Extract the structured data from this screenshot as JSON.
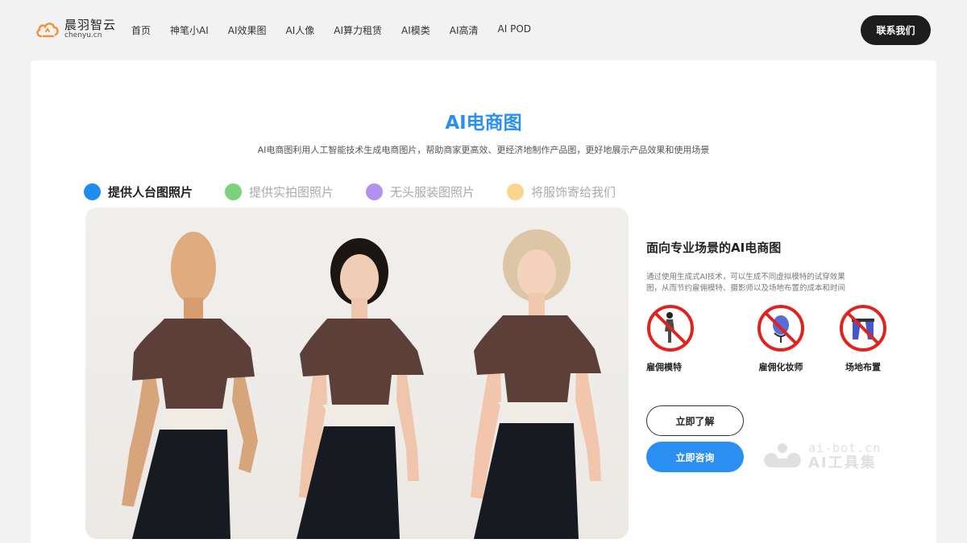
{
  "header": {
    "logo_name": "晨羽智云",
    "logo_domain": "chenyu.cn",
    "nav": [
      "首页",
      "神笔小AI",
      "AI效果图",
      "AI人像",
      "AI算力租赁",
      "AI模类",
      "AI高清",
      "AI POD"
    ],
    "contact_label": "联系我们"
  },
  "hero": {
    "title": "AI电商图",
    "subtitle": "AI电商图利用人工智能技术生成电商图片，帮助商家更高效、更经济地制作产品图，更好地展示产品效果和使用场景"
  },
  "tabs": [
    {
      "label": "提供人台图照片",
      "color": "#1f8df0",
      "active": true
    },
    {
      "label": "提供实拍图照片",
      "color": "#7ad27a",
      "active": false
    },
    {
      "label": "无头服装图照片",
      "color": "#b192ee",
      "active": false
    },
    {
      "label": "将服饰寄给我们",
      "color": "#f8d690",
      "active": false
    }
  ],
  "side": {
    "title": "面向专业场景的AI电商图",
    "desc": "通过使用生成式AI技术，可以生成不同虚拟模特的试穿效果图，从而节约雇佣模特、摄影师以及场地布置的成本和时间",
    "icons": [
      {
        "label": "雇佣模特",
        "icon": "no-model-icon"
      },
      {
        "label": "雇佣化妆师",
        "icon": "no-makeup-artist-icon"
      },
      {
        "label": "场地布置",
        "icon": "no-venue-icon"
      }
    ],
    "learn_label": "立即了解",
    "consult_label": "立即咨询"
  },
  "watermark": {
    "domain": "ai-bot.cn",
    "name": "AI工具集"
  },
  "colors": {
    "accent": "#2a8ff0",
    "dark_button": "#1d1d1d",
    "prohibit_red": "#e0231f"
  }
}
